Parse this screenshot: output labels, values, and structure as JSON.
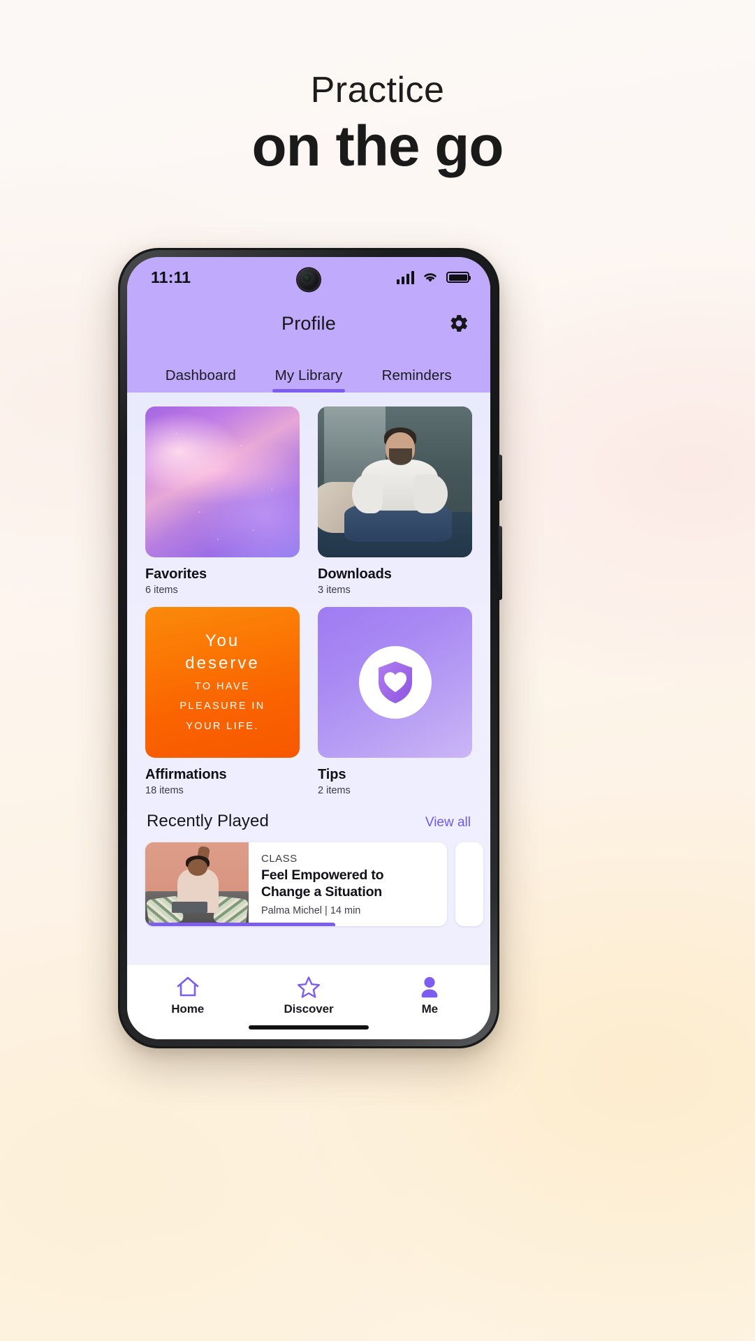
{
  "promo": {
    "line1": "Practice",
    "line2": "on the go"
  },
  "device": {
    "status": {
      "time": "11:11",
      "signal_icon": "signal-bars-icon",
      "wifi_icon": "wifi-icon",
      "battery_icon": "battery-icon",
      "camera": "front-camera-punchhole"
    },
    "home_indicator": "home-indicator"
  },
  "appbar": {
    "title": "Profile",
    "settings_icon": "gear-icon"
  },
  "tabs": [
    {
      "label": "Dashboard",
      "active": false
    },
    {
      "label": "My Library",
      "active": true
    },
    {
      "label": "Reminders",
      "active": false
    }
  ],
  "library": {
    "cards": [
      {
        "name": "Favorites",
        "count": "6 items",
        "art": "aurora-gradient"
      },
      {
        "name": "Downloads",
        "count": "3 items",
        "art": "meditating-man-photo"
      },
      {
        "name": "Affirmations",
        "count": "18 items",
        "art": "orange-quote"
      },
      {
        "name": "Tips",
        "count": "2 items",
        "art": "shield-heart-badge"
      }
    ],
    "affirmation_card": {
      "line1": "You",
      "line2": "deserve",
      "line3": "TO HAVE",
      "line4": "PLEASURE IN",
      "line5": "YOUR LIFE."
    },
    "tips_card": {
      "icon": "shield-heart-icon"
    }
  },
  "recently_played": {
    "title": "Recently Played",
    "view_all": "View all",
    "item": {
      "kicker": "CLASS",
      "title_line1": "Feel Empowered to",
      "title_line2": "Change a Situation",
      "meta": "Palma Michel | 14 min",
      "progress_percent": 63
    }
  },
  "bottom_nav": [
    {
      "label": "Home",
      "icon": "home-icon",
      "active": false
    },
    {
      "label": "Discover",
      "icon": "star-icon",
      "active": false
    },
    {
      "label": "Me",
      "icon": "person-icon",
      "active": true
    }
  ],
  "colors": {
    "accent": "#7d5cf0",
    "header_purple": "#bfaafb",
    "content_bg": "#eeeefd",
    "link": "#6f5ae8"
  }
}
